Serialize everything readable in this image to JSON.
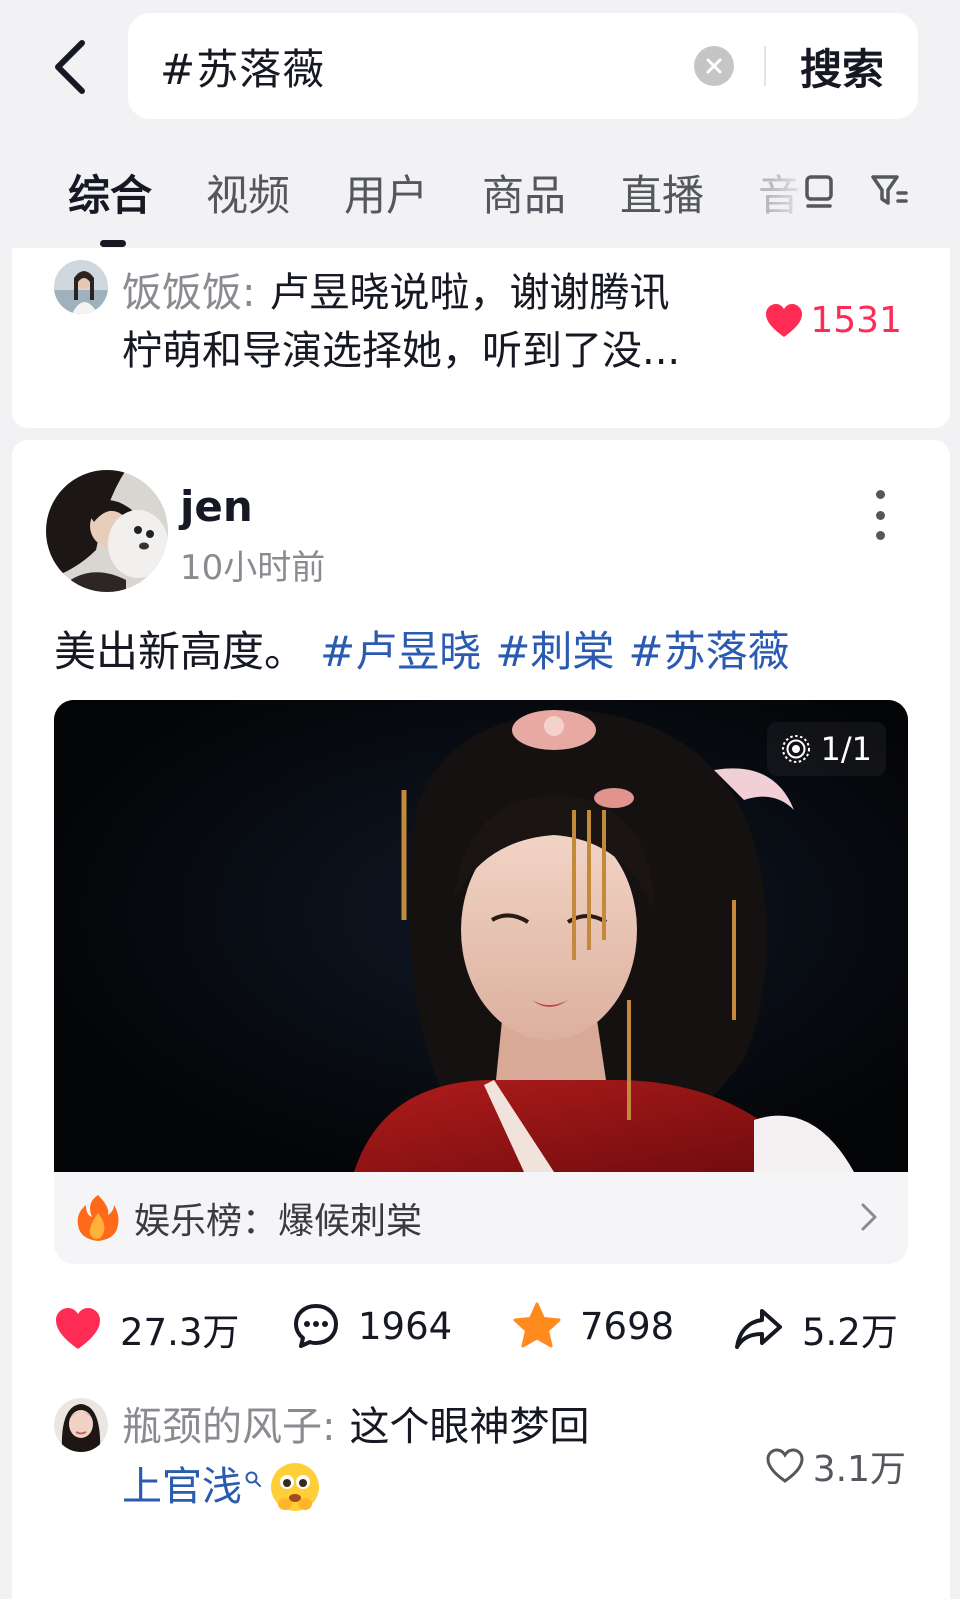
{
  "search": {
    "query": "#苏落薇",
    "button_label": "搜索"
  },
  "tabs": [
    {
      "label": "综合",
      "active": true
    },
    {
      "label": "视频",
      "active": false
    },
    {
      "label": "用户",
      "active": false
    },
    {
      "label": "商品",
      "active": false
    },
    {
      "label": "直播",
      "active": false
    },
    {
      "label": "音",
      "active": false
    }
  ],
  "top_comment": {
    "user": "饭饭饭:",
    "text_line1": "卢昱晓说啦，谢谢腾讯",
    "text_line2": "柠萌和导演选择她，听到了没...",
    "likes": "1531",
    "like_color": "#fe2c55"
  },
  "post": {
    "username": "jen",
    "time": "10小时前",
    "caption": "美出新高度。",
    "hashtags": [
      "#卢昱晓",
      "#刺棠",
      "#苏落薇"
    ],
    "image_counter": "1/1",
    "ranking": "娱乐榜：爆候刺棠",
    "stats": {
      "likes": "27.3万",
      "comments": "1964",
      "favorites": "7698",
      "shares": "5.2万"
    },
    "comment": {
      "user": "瓶颈的风子:",
      "text_line1": "这个眼神梦回",
      "link": "上官浅",
      "likes": "3.1万"
    }
  },
  "colors": {
    "hashtag": "#2a5bb0",
    "like_red": "#fe2c55",
    "star_orange": "#ff8a1e"
  }
}
